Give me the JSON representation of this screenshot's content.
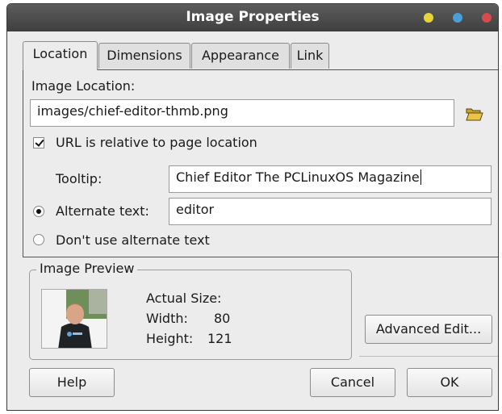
{
  "window": {
    "title": "Image Properties"
  },
  "tabs": [
    {
      "label": "Location"
    },
    {
      "label": "Dimensions"
    },
    {
      "label": "Appearance"
    },
    {
      "label": "Link"
    }
  ],
  "location": {
    "image_location_label": "Image Location:",
    "image_location_value": "images/chief-editor-thmb.png",
    "url_relative_label": "URL is relative to page location",
    "url_relative_checked": true,
    "tooltip_label": "Tooltip:",
    "tooltip_value": "Chief Editor The PCLinuxOS Magazine",
    "alt_text_label": "Alternate text:",
    "alt_text_value": "editor",
    "alt_text_selected": true,
    "no_alt_text_label": "Don't use alternate text"
  },
  "preview": {
    "legend": "Image Preview",
    "actual_size_label": "Actual Size:",
    "width_label": "Width:",
    "width_value": "80",
    "height_label": "Height:",
    "height_value": "121"
  },
  "buttons": {
    "advanced_edit": "Advanced Edit...",
    "help": "Help",
    "cancel": "Cancel",
    "ok": "OK"
  },
  "icons": {
    "browse": "folder-open-icon",
    "minimize": "yellow-dot",
    "maximize": "blue-dot",
    "close": "red-dot"
  },
  "colors": {
    "titlebar": "#4a4a4a",
    "window_bg": "#ececec"
  }
}
